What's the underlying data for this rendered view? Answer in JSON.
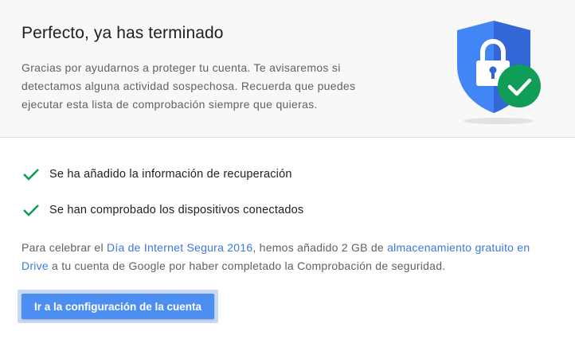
{
  "header": {
    "title": "Perfecto, ya has terminado",
    "description": "Gracias por ayudarnos a proteger tu cuenta. Te avisaremos si detectamos alguna actividad sospechosa. Recuerda que puedes ejecutar esta lista de comprobación siempre que quieras."
  },
  "checklist": [
    {
      "label": "Se ha añadido la información de recuperación",
      "icon": "checkmark-icon"
    },
    {
      "label": "Se han comprobado los dispositivos conectados",
      "icon": "checkmark-icon"
    }
  ],
  "promo": {
    "text_before": "Para celebrar el ",
    "link1": "Día de Internet Segura 2016",
    "text_middle": ", hemos añadido 2 GB de ",
    "link2": "almacenamiento gratuito en Drive",
    "text_after": " a tu cuenta de Google por haber completado la Comprobación de seguridad."
  },
  "action": {
    "button_label": "Ir a la configuración de la cuenta"
  },
  "illustration": {
    "icon": "shield-lock-icon",
    "badge_icon": "check-badge-icon"
  },
  "colors": {
    "shield_blue": "#4285f4",
    "shield_dark": "#3367d6",
    "check_green": "#0f9d58",
    "accent_button": "#4d8ef3",
    "link": "#3c78d8"
  }
}
